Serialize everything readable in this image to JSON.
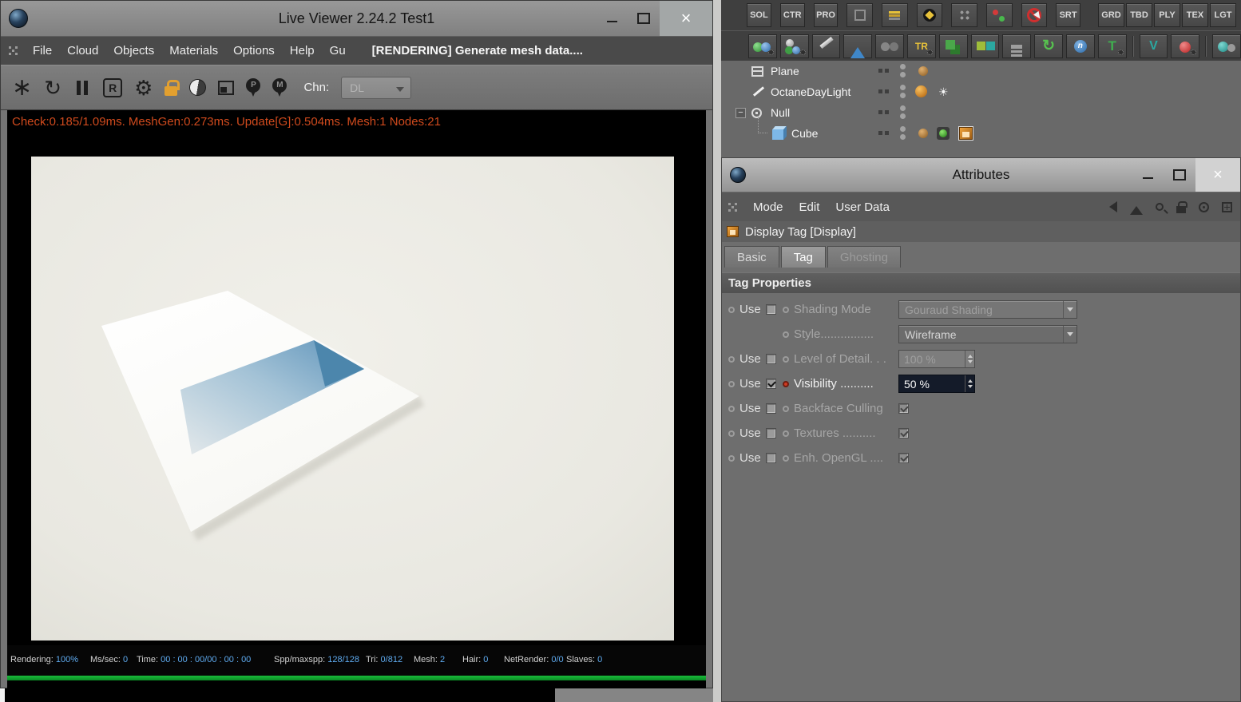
{
  "icons": {
    "window_close": "×",
    "restart": "∗",
    "reset": "↻",
    "region": "R",
    "gear": "⚙",
    "pin_p": "P",
    "pin_m": "M",
    "collapse": "−",
    "sun": "☀",
    "tr": "TR",
    "n": "n",
    "t": "T",
    "v": "V",
    "refresh": "↻"
  },
  "live_viewer": {
    "title": "Live Viewer 2.24.2 Test1",
    "menu": [
      "File",
      "Cloud",
      "Objects",
      "Materials",
      "Options",
      "Help",
      "Gu"
    ],
    "status_message": "[RENDERING] Generate mesh data....",
    "channel_label": "Chn:",
    "channel_value": "DL",
    "render_stats": "Check:0.185/1.09ms. MeshGen:0.273ms. Update[G]:0.504ms. Mesh:1 Nodes:21",
    "footer": {
      "rendering_label": "Rendering:",
      "rendering_value": "100%",
      "ms_label": "Ms/sec:",
      "ms_value": "0",
      "time_label": "Time:",
      "time_value": "00 : 00 : 00/00 : 00 : 00",
      "spp_label": "Spp/maxspp:",
      "spp_value": "128/128",
      "tri_label": "Tri:",
      "tri_value": "0/812",
      "mesh_label": "Mesh:",
      "mesh_value": "2",
      "hair_label": "Hair:",
      "hair_value": "0",
      "net_label": "NetRender:",
      "net_value": "0/0",
      "slaves_label": "Slaves:",
      "slaves_value": "0"
    }
  },
  "top_toolbar": {
    "sol": "SOL",
    "ctr": "CTR",
    "pro": "PRO",
    "srt": "SRT",
    "right": [
      "GRD",
      "TBD",
      "PLY",
      "TEX",
      "LGT"
    ]
  },
  "object_manager": {
    "items": [
      "Plane",
      "OctaneDayLight",
      "Null",
      "Cube"
    ]
  },
  "attributes": {
    "title": "Attributes",
    "menu": [
      "Mode",
      "Edit",
      "User Data"
    ],
    "object_header": "Display Tag [Display]",
    "tabs": [
      "Basic",
      "Tag",
      "Ghosting"
    ],
    "section": "Tag Properties",
    "use_label": "Use",
    "rows": {
      "shading_mode": {
        "label": "Shading Mode",
        "value": "Gouraud Shading"
      },
      "style": {
        "label": "Style................",
        "value": "Wireframe"
      },
      "level_of_detail": {
        "label": "Level of Detail. . .",
        "value": "100 %"
      },
      "visibility": {
        "label": "Visibility ..........",
        "value": "50 %"
      },
      "backface_culling": {
        "label": "Backface Culling"
      },
      "textures": {
        "label": "Textures .........."
      },
      "enh_opengl": {
        "label": "Enh. OpenGL ...."
      }
    }
  }
}
